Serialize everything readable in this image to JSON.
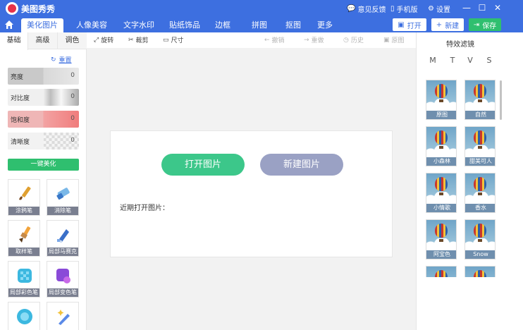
{
  "app": {
    "title": "美图秀秀"
  },
  "titlebar": {
    "feedback": "意见反馈",
    "mobile": "手机版",
    "settings": "设置"
  },
  "tabs": [
    "美化图片",
    "人像美容",
    "文字水印",
    "贴纸饰品",
    "边框",
    "拼图",
    "抠图",
    "更多"
  ],
  "actions": {
    "open": "打开",
    "new": "新建",
    "save": "保存"
  },
  "left": {
    "tabs": [
      "基础",
      "高级",
      "调色"
    ],
    "reset": "重置",
    "sliders": [
      {
        "label": "亮度",
        "value": "0"
      },
      {
        "label": "对比度",
        "value": "0"
      },
      {
        "label": "饱和度",
        "value": "0"
      },
      {
        "label": "清晰度",
        "value": "0"
      }
    ],
    "onekey": "一键美化",
    "tools": [
      "涂鸦笔",
      "消除笔",
      "取样笔",
      "局部马赛克",
      "局部彩色笔",
      "局部变色笔"
    ]
  },
  "toolbar": {
    "rotate": "旋转",
    "crop": "裁剪",
    "size": "尺寸",
    "undo": "撤销",
    "redo": "重做",
    "history": "历史",
    "original": "原图"
  },
  "canvas": {
    "open_label": "打开图片",
    "new_label": "新建图片",
    "recent_label": "近期打开图片："
  },
  "right": {
    "title": "特效滤镜",
    "tabs": [
      "M",
      "T",
      "V",
      "S"
    ],
    "filters": [
      "原图",
      "自然",
      "小森林",
      "甜美可人",
      "小情歌",
      "香水",
      "阿宝色",
      "Snow"
    ]
  },
  "colors": {
    "primary": "#3d6fe0",
    "accent": "#2fbf6f",
    "open_button": "#3cc78a",
    "new_button": "#9aa1c4"
  }
}
